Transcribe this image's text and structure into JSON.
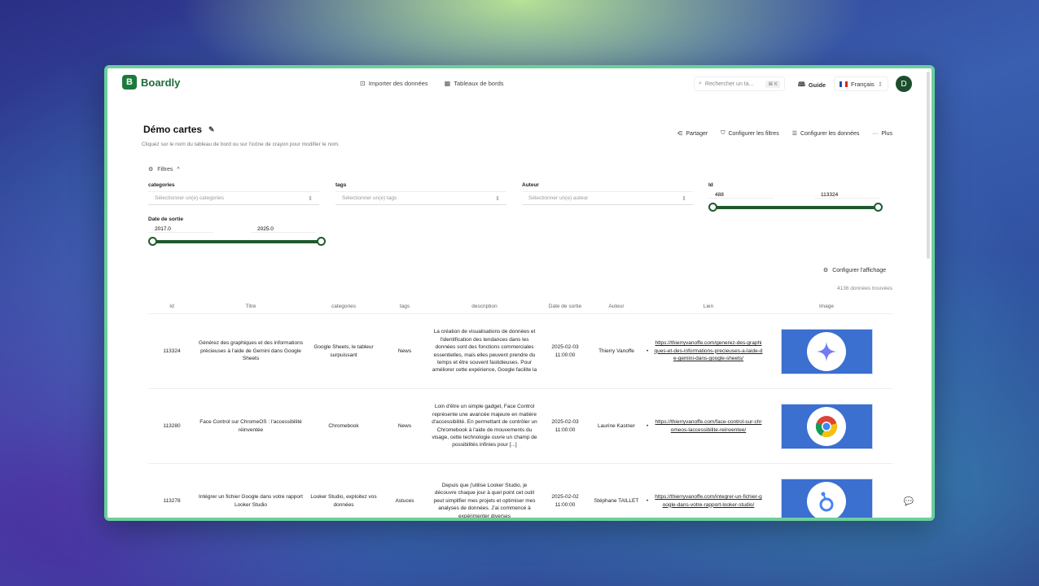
{
  "brand": {
    "name": "Boardly",
    "logo": "B"
  },
  "nav": [
    {
      "label": "Importer des données",
      "icon": "import-icon"
    },
    {
      "label": "Tableaux de bords",
      "icon": "dashboard-icon"
    }
  ],
  "search": {
    "placeholder": "Rechercher un ta...",
    "shortcut": "⌘ K"
  },
  "guide": {
    "label": "Guide"
  },
  "language": {
    "label": "Français"
  },
  "user": {
    "initial": "D"
  },
  "page": {
    "title": "Démo cartes",
    "subtitle": "Cliquez sur le nom du tableau de bord ou sur l'icône de crayon pour modifier le nom."
  },
  "actions": {
    "share": "Partager",
    "filters": "Configurer les filtres",
    "data": "Configurer les données",
    "more": "Plus"
  },
  "filters": {
    "toggle": "Filtres",
    "categories": {
      "label": "categories",
      "placeholder": "Sélectionner un(e) categories"
    },
    "tags": {
      "label": "tags",
      "placeholder": "Sélectionner un(e) tags"
    },
    "author": {
      "label": "Auteur",
      "placeholder": "Sélectionner un(e) auteur"
    },
    "id": {
      "label": "Id",
      "min": "488",
      "max": "113324"
    },
    "date": {
      "label": "Date de sortie",
      "min": "2017.0",
      "max": "2025.0"
    }
  },
  "display": {
    "config_label": "Configurer l'affichage",
    "count": "4136 données trouvées"
  },
  "table": {
    "headers": [
      "Id",
      "Titre",
      "categories",
      "tags",
      "description",
      "Date de sortie",
      "Auteur",
      "Lien",
      "Image"
    ],
    "rows": [
      {
        "id": "113324",
        "title": "Générez des graphiques et des informations précieuses à l'aide de Gemini dans Google Sheets",
        "categories": "Google Sheets, le tableur surpuissant",
        "tags": "News",
        "description": "La création de visualisations de données et l'identification des tendances dans les données sont des fonctions commerciales essentielles, mais elles peuvent prendre du temps et être souvent fastidieuses. Pour améliorer cette expérience, Google facilite la",
        "date": "2025-02-03",
        "time": "11:00:00",
        "author": "Thierry Vanoffe",
        "link": "https://thierryvanoffe.com/generez-des-graphiques-et-des-informations-precieuses-a-laide-de-gemini-dans-google-sheets/",
        "image": "gemini-icon"
      },
      {
        "id": "113280",
        "title": "Face Control sur ChromeOS : l'accessibilité réinventée",
        "categories": "Chromebook",
        "tags": "News",
        "description": "Loin d'être un simple gadget, Face Control représente une avancée majeure en matière d'accessibilité. En permettant de contrôler un Chromebook à l'aide de mouvements du visage, cette technologie ouvre un champ de possibilités infinies pour [...]",
        "date": "2025-02-03",
        "time": "11:00:00",
        "author": "Laurine Kastner",
        "link": "https://thierryvanoffe.com/face-control-sur-chromeos-laccessibilite-reinventee/",
        "image": "chrome-icon"
      },
      {
        "id": "113278",
        "title": "Intégrer un fichier Google dans votre rapport Looker Studio",
        "categories": "Looker Studio, exploitez vos données",
        "tags": "Astuces",
        "description": "Depuis que j'utilise Looker Studio, je découvre chaque jour à quel point cet outil peut simplifier mes projets et optimiser mes analyses de données. J'ai commencé à expérimenter diverses",
        "date": "2025-02-02",
        "time": "11:00:00",
        "author": "Stéphane TAILLET",
        "link": "https://thierryvanoffe.com/integrer-un-fichier-google-dans-votre-rapport-looker-studio/",
        "image": "looker-icon"
      }
    ]
  }
}
